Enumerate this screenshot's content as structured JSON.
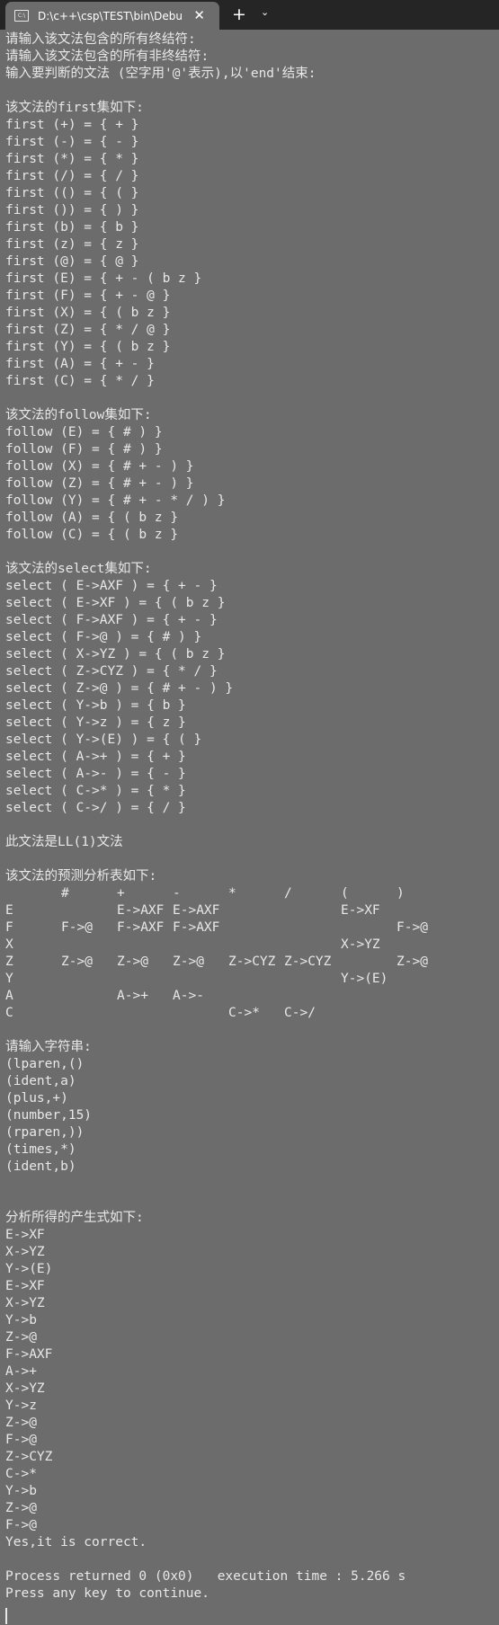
{
  "window": {
    "tab_title": "D:\\c++\\csp\\TEST\\bin\\Debu",
    "tab_icon": "terminal-icon",
    "close_glyph": "✕",
    "new_tab_glyph": "+",
    "dropdown_glyph": "⌄"
  },
  "console": {
    "lines_a": [
      "请输入该文法包含的所有终结符:",
      "请输入该文法包含的所有非终结符:",
      "输入要判断的文法 (空字用'@'表示),以'end'结束:",
      "",
      "该文法的first集如下:",
      "first (+) = { + }",
      "first (-) = { - }",
      "first (*) = { * }",
      "first (/) = { / }",
      "first (() = { ( }",
      "first ()) = { ) }",
      "first (b) = { b }",
      "first (z) = { z }",
      "first (@) = { @ }",
      "first (E) = { + - ( b z }",
      "first (F) = { + - @ }",
      "first (X) = { ( b z }",
      "first (Z) = { * / @ }",
      "first (Y) = { ( b z }",
      "first (A) = { + - }",
      "first (C) = { * / }",
      "",
      "该文法的follow集如下:",
      "follow (E) = { # ) }",
      "follow (F) = { # ) }",
      "follow (X) = { # + - ) }",
      "follow (Z) = { # + - ) }",
      "follow (Y) = { # + - * / ) }",
      "follow (A) = { ( b z }",
      "follow (C) = { ( b z }",
      "",
      "该文法的select集如下:",
      "select ( E->AXF ) = { + - }",
      "select ( E->XF ) = { ( b z }",
      "select ( F->AXF ) = { + - }",
      "select ( F->@ ) = { # ) }",
      "select ( X->YZ ) = { ( b z }",
      "select ( Z->CYZ ) = { * / }",
      "select ( Z->@ ) = { # + - ) }",
      "select ( Y->b ) = { b }",
      "select ( Y->z ) = { z }",
      "select ( Y->(E) ) = { ( }",
      "select ( A->+ ) = { + }",
      "select ( A->- ) = { - }",
      "select ( C->* ) = { * }",
      "select ( C->/ ) = { / }",
      "",
      "此文法是LL(1)文法",
      "",
      "该文法的预测分析表如下:"
    ],
    "table": {
      "header": [
        "#",
        "+",
        "-",
        "*",
        "/",
        "(",
        ")"
      ],
      "rows": [
        {
          "nt": "E",
          "cells": [
            "",
            "E->AXF",
            "E->AXF",
            "",
            "",
            "E->XF",
            ""
          ]
        },
        {
          "nt": "F",
          "cells": [
            "F->@",
            "F->AXF",
            "F->AXF",
            "",
            "",
            "",
            "F->@"
          ]
        },
        {
          "nt": "X",
          "cells": [
            "",
            "",
            "",
            "",
            "",
            "X->YZ",
            ""
          ]
        },
        {
          "nt": "Z",
          "cells": [
            "Z->@",
            "Z->@",
            "Z->@",
            "Z->CYZ",
            "Z->CYZ",
            "",
            "Z->@"
          ]
        },
        {
          "nt": "Y",
          "cells": [
            "",
            "",
            "",
            "",
            "",
            "Y->(E)",
            ""
          ]
        },
        {
          "nt": "A",
          "cells": [
            "",
            "A->+",
            "A->-",
            "",
            "",
            "",
            ""
          ]
        },
        {
          "nt": "C",
          "cells": [
            "",
            "",
            "",
            "C->*",
            "C->/",
            "",
            ""
          ]
        }
      ]
    },
    "lines_b": [
      "",
      "请输入字符串:",
      "(lparen,()",
      "(ident,a)",
      "(plus,+)",
      "(number,15)",
      "(rparen,))",
      "(times,*)",
      "(ident,b)",
      "",
      "",
      "分析所得的产生式如下:",
      "E->XF",
      "X->YZ",
      "Y->(E)",
      "E->XF",
      "X->YZ",
      "Y->b",
      "Z->@",
      "F->AXF",
      "A->+",
      "X->YZ",
      "Y->z",
      "Z->@",
      "F->@",
      "Z->CYZ",
      "C->*",
      "Y->b",
      "Z->@",
      "F->@",
      "Yes,it is correct.",
      "",
      "Process returned 0 (0x0)   execution time : 5.266 s",
      "Press any key to continue."
    ]
  }
}
